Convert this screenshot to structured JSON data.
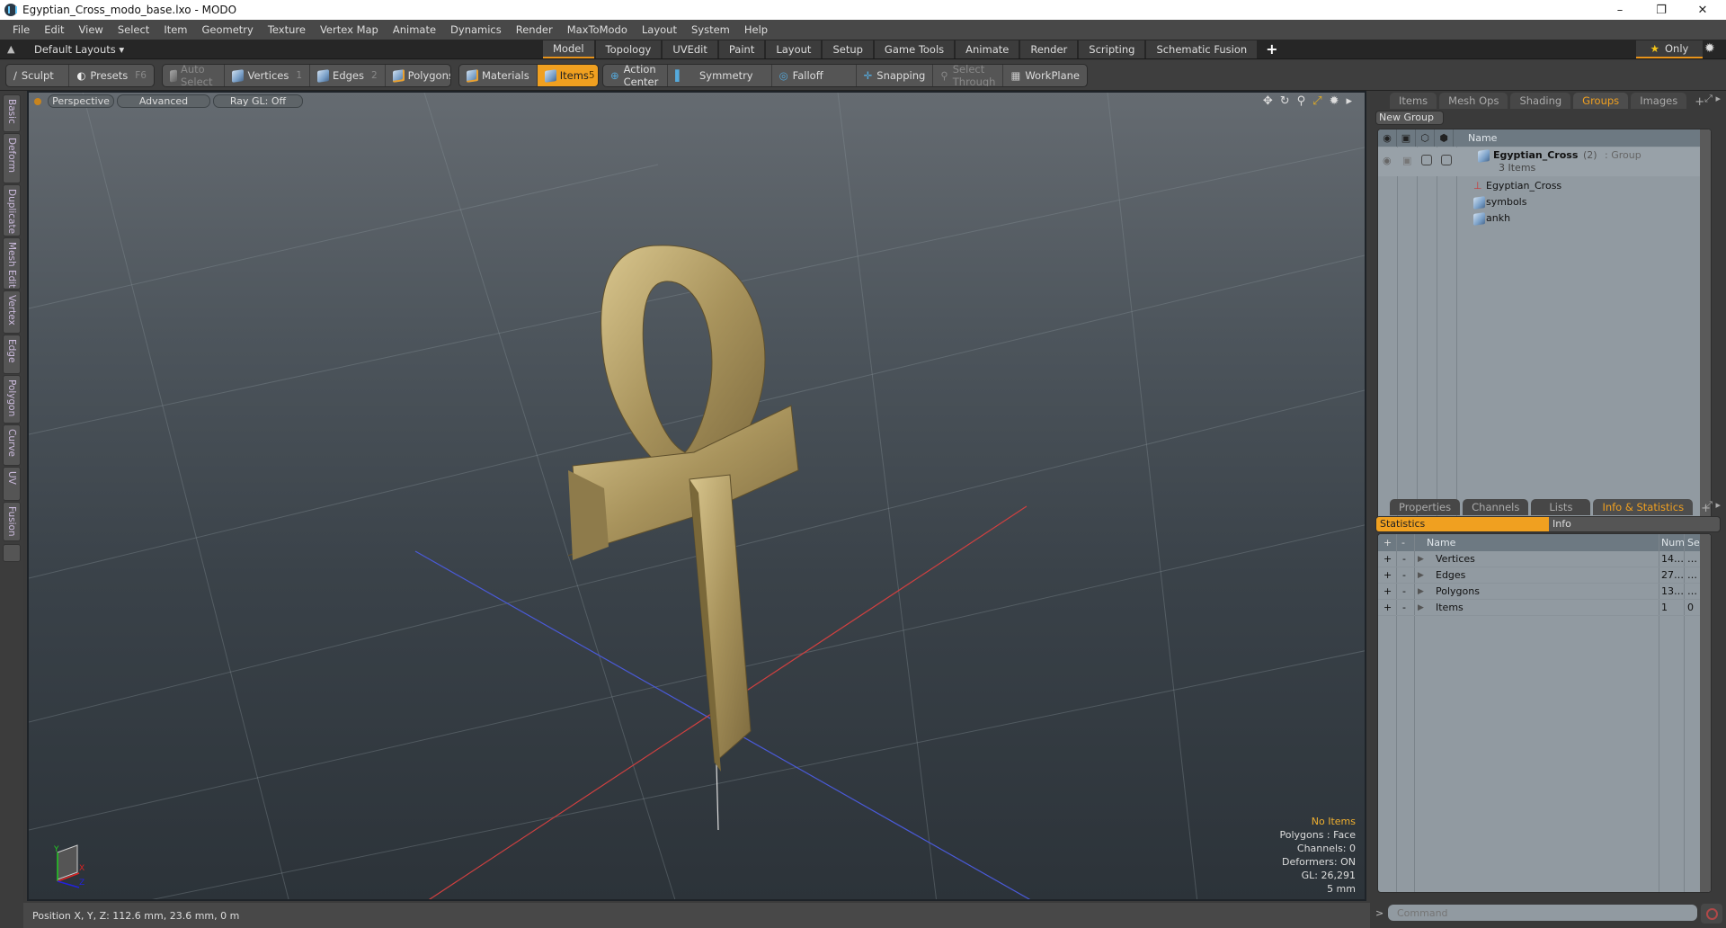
{
  "window": {
    "title": "Egyptian_Cross_modo_base.lxo - MODO",
    "controls": {
      "minimize": "–",
      "restore": "❐",
      "close": "✕"
    }
  },
  "menubar": [
    "File",
    "Edit",
    "View",
    "Select",
    "Item",
    "Geometry",
    "Texture",
    "Vertex Map",
    "Animate",
    "Dynamics",
    "Render",
    "MaxToModo",
    "Layout",
    "System",
    "Help"
  ],
  "layoutbar": {
    "layouts_label": "Default Layouts ▾",
    "mode_tabs": [
      {
        "label": "Model",
        "active": true
      },
      {
        "label": "Topology"
      },
      {
        "label": "UVEdit"
      },
      {
        "label": "Paint"
      },
      {
        "label": "Layout"
      },
      {
        "label": "Setup"
      },
      {
        "label": "Game Tools"
      },
      {
        "label": "Animate"
      },
      {
        "label": "Render"
      },
      {
        "label": "Scripting"
      },
      {
        "label": "Schematic Fusion"
      }
    ],
    "add_tab": "+",
    "only_label": "Only",
    "only_icon": "★",
    "settings_icon": "✹"
  },
  "toolbar": {
    "sculpt": "Sculpt",
    "presets": "Presets",
    "presets_key": "F6",
    "auto_select": "Auto Select",
    "vertices": "Vertices",
    "vertices_key": "1",
    "edges": "Edges",
    "edges_key": "2",
    "polygons": "Polygons",
    "materials": "Materials",
    "items": "Items",
    "items_key": "5",
    "action_center": "Action Center",
    "symmetry": "Symmetry",
    "falloff": "Falloff",
    "snapping": "Snapping",
    "select_through": "Select Through",
    "workplane": "WorkPlane"
  },
  "sidebar_tabs": [
    "Basic",
    "Deform",
    "Duplicate",
    "Mesh Edit",
    "Vertex",
    "Edge",
    "Polygon",
    "Curve",
    "UV",
    "Fusion"
  ],
  "viewport": {
    "view_mode": "Perspective",
    "shading": "Advanced",
    "raygl": "Ray GL: Off",
    "hud": {
      "selection": "No Items",
      "polygons": "Polygons : Face",
      "channels": "Channels: 0",
      "deformers": "Deformers: ON",
      "gl": "GL: 26,291",
      "grid": "5 mm"
    },
    "axes": {
      "x": "X",
      "y": "Y",
      "z": "Z"
    }
  },
  "statusbar": {
    "position": "Position X, Y, Z:   112.6 mm, 23.6 mm, 0 m"
  },
  "groups_panel": {
    "tabs": [
      {
        "label": "Items"
      },
      {
        "label": "Mesh Ops"
      },
      {
        "label": "Shading"
      },
      {
        "label": "Groups",
        "active": true
      },
      {
        "label": "Images"
      }
    ],
    "add_tab": "+",
    "new_group": "New Group",
    "column_name": "Name",
    "group": {
      "name": "Egyptian_Cross",
      "count": "(2)",
      "type": ": Group",
      "subtitle": "3 Items"
    },
    "children": [
      {
        "name": "Egyptian_Cross",
        "icon": "locator"
      },
      {
        "name": "symbols",
        "icon": "mesh"
      },
      {
        "name": "ankh",
        "icon": "mesh"
      }
    ]
  },
  "stats_panel": {
    "tabs": [
      {
        "label": "Properties"
      },
      {
        "label": "Channels"
      },
      {
        "label": "Lists"
      },
      {
        "label": "Info & Statistics",
        "active": true
      }
    ],
    "add_tab": "+",
    "subtabs": {
      "statistics": "Statistics",
      "info": "Info"
    },
    "columns": {
      "plus": "+",
      "minus": "-",
      "name": "Name",
      "num": "Num",
      "sel": "Sel"
    },
    "rows": [
      {
        "name": "Vertices",
        "num": "14…",
        "sel": "…"
      },
      {
        "name": "Edges",
        "num": "27…",
        "sel": "…"
      },
      {
        "name": "Polygons",
        "num": "13…",
        "sel": "…"
      },
      {
        "name": "Items",
        "num": "1",
        "sel": "0"
      }
    ]
  },
  "command": {
    "prompt": ">",
    "placeholder": "Command"
  },
  "colors": {
    "accent": "#f0a020",
    "viewport_top": "#656b71",
    "viewport_bottom": "#2c3339",
    "list_bg": "#919aa1",
    "ankh_gold": "#b8a46e"
  }
}
